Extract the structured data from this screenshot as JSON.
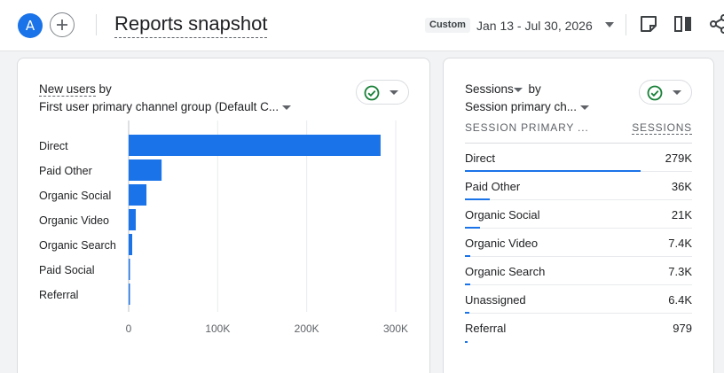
{
  "header": {
    "avatar_letter": "A",
    "title": "Reports snapshot",
    "compare_label": "Custom",
    "date_range": "Jan 13 - Jul 30, 2026"
  },
  "colors": {
    "accent": "#1a73e8",
    "check": "#188038"
  },
  "left_card": {
    "metric": "New users",
    "by": "by",
    "dimension": "First user primary channel group (Default C...",
    "chart_data": {
      "type": "bar",
      "orientation": "horizontal",
      "categories": [
        "Direct",
        "Paid Other",
        "Organic Social",
        "Organic Video",
        "Organic Search",
        "Paid Social",
        "Referral"
      ],
      "values": [
        283000,
        37000,
        20000,
        8000,
        4000,
        1000,
        700
      ],
      "xlim": [
        0,
        300000
      ],
      "xticks": [
        0,
        100000,
        200000,
        300000
      ],
      "xtick_labels": [
        "0",
        "100K",
        "200K",
        "300K"
      ],
      "grid": true
    }
  },
  "right_card": {
    "metric": "Sessions",
    "by": "by",
    "dimension": "Session primary ch...",
    "col_left": "SESSION PRIMARY ...",
    "col_right": "SESSIONS",
    "rows": [
      {
        "name": "Direct",
        "value": "279K",
        "share": 0.775
      },
      {
        "name": "Paid Other",
        "value": "36K",
        "share": 0.11
      },
      {
        "name": "Organic Social",
        "value": "21K",
        "share": 0.065
      },
      {
        "name": "Organic Video",
        "value": "7.4K",
        "share": 0.025
      },
      {
        "name": "Organic Search",
        "value": "7.3K",
        "share": 0.024
      },
      {
        "name": "Unassigned",
        "value": "6.4K",
        "share": 0.021
      },
      {
        "name": "Referral",
        "value": "979",
        "share": 0.004
      }
    ]
  }
}
